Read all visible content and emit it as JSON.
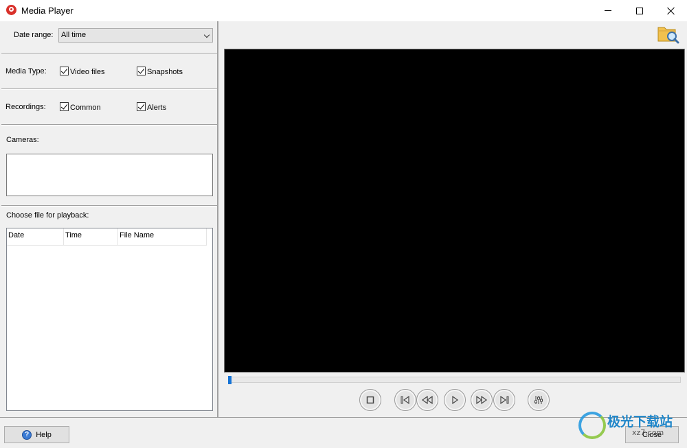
{
  "window": {
    "title": "Media Player"
  },
  "left": {
    "date_range_label": "Date range:",
    "date_range_value": "All time",
    "media_type_label": "Media Type:",
    "media_type_options": [
      {
        "label": "Video files",
        "checked": true
      },
      {
        "label": "Snapshots",
        "checked": true
      }
    ],
    "recordings_label": "Recordings:",
    "recordings_options": [
      {
        "label": "Common",
        "checked": true
      },
      {
        "label": "Alerts",
        "checked": true
      }
    ],
    "cameras_label": "Cameras:",
    "playback_label": "Choose file for playback:",
    "columns": [
      "Date",
      "Time",
      "File Name"
    ]
  },
  "player": {
    "seek_position": 0,
    "controls": [
      "stop-icon",
      "skip-to-start-icon",
      "rewind-icon",
      "play-icon",
      "fast-forward-icon",
      "skip-to-end-icon",
      "equalizer-icon"
    ],
    "accent_color": "#1473d6"
  },
  "footer": {
    "help_label": "Help",
    "close_label": "Close"
  },
  "watermark": {
    "text": "极光下载站",
    "url": "xz7.com"
  }
}
